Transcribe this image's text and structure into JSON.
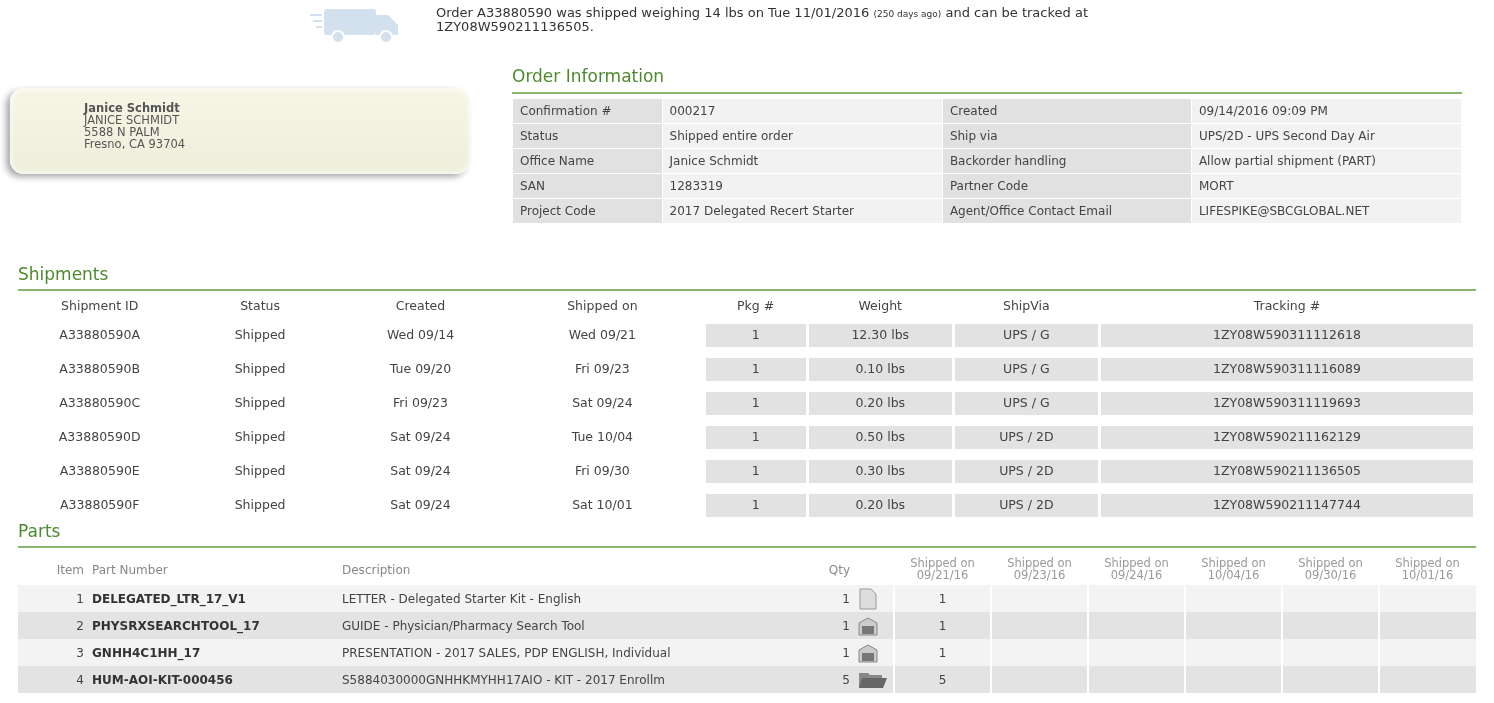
{
  "banner": {
    "text": "Order A33880590 was shipped weighing 14 lbs on Tue 11/01/2016",
    "age": "(250 days ago)",
    "text_after": "and can be tracked at",
    "tracking_link": "1ZY08W590211136505",
    "end": "."
  },
  "address": {
    "lines": [
      "Janice Schmidt",
      "JANICE SCHMIDT",
      "5588 N PALM",
      "Fresno, CA  93704"
    ]
  },
  "order_information": {
    "title": "Order Information",
    "rows": [
      {
        "label": "Confirmation #",
        "value": "000217",
        "label_2": "Created",
        "value_2": "09/14/2016 09:09 PM"
      },
      {
        "label": "Status",
        "value": "Shipped entire order",
        "label_2": "Ship via",
        "value_2": "UPS/2D - UPS Second Day Air"
      },
      {
        "label": "Office Name",
        "value": "Janice Schmidt",
        "label_2": "Backorder handling",
        "value_2": "Allow partial shipment (PART)"
      },
      {
        "label": "SAN",
        "value": "1283319",
        "label_2": "Partner Code",
        "value_2": "MORT"
      },
      {
        "label": "Project Code",
        "value": "2017 Delegated Recert Starter",
        "label_2": "Agent/Office Contact Email",
        "value_2": "LIFESPIKE@SBCGLOBAL.NET"
      }
    ]
  },
  "shipments": {
    "title": "Shipments",
    "columns": [
      "Shipment ID",
      "Status",
      "Created",
      "Shipped on",
      "Pkg #",
      "Weight",
      "ShipVia",
      "Tracking #"
    ],
    "rows": [
      [
        "A33880590A",
        "Shipped",
        "Wed 09/14",
        "Wed 09/21",
        "1",
        "12.30 lbs",
        "UPS / G",
        "1ZY08W590311112618"
      ],
      [
        "A33880590B",
        "Shipped",
        "Tue 09/20",
        "Fri 09/23",
        "1",
        "0.10 lbs",
        "UPS / G",
        "1ZY08W590311116089"
      ],
      [
        "A33880590C",
        "Shipped",
        "Fri 09/23",
        "Sat 09/24",
        "1",
        "0.20 lbs",
        "UPS / G",
        "1ZY08W590311119693"
      ],
      [
        "A33880590D",
        "Shipped",
        "Sat 09/24",
        "Tue 10/04",
        "1",
        "0.50 lbs",
        "UPS / 2D",
        "1ZY08W590211162129"
      ],
      [
        "A33880590E",
        "Shipped",
        "Sat 09/24",
        "Fri 09/30",
        "1",
        "0.30 lbs",
        "UPS / 2D",
        "1ZY08W590211136505"
      ],
      [
        "A33880590F",
        "Shipped",
        "Sat 09/24",
        "Sat 10/01",
        "1",
        "0.20 lbs",
        "UPS / 2D",
        "1ZY08W590211147744"
      ]
    ]
  },
  "parts": {
    "title": "Parts",
    "columns": [
      "Item",
      "Part Number",
      "Description",
      "Qty"
    ],
    "shipped_columns": [
      [
        "Shipped on",
        "09/21/16"
      ],
      [
        "Shipped on",
        "09/23/16"
      ],
      [
        "Shipped on",
        "09/24/16"
      ],
      [
        "Shipped on",
        "10/04/16"
      ],
      [
        "Shipped on",
        "09/30/16"
      ],
      [
        "Shipped on",
        "10/01/16"
      ]
    ],
    "rows": [
      {
        "item": "1",
        "part_number": "DELEGATED_LTR_17_V1",
        "description": "LETTER - Delegated Starter Kit - English",
        "qty": "1",
        "kind": "document",
        "shipped_qty": "1"
      },
      {
        "item": "2",
        "part_number": "PHYSRXSEARCHTOOL_17",
        "description": "GUIDE - Physician/Pharmacy Search Tool",
        "qty": "1",
        "kind": "warehouse",
        "shipped_qty": "1"
      },
      {
        "item": "3",
        "part_number": "GNHH4C1HH_17",
        "description": "PRESENTATION - 2017 SALES, PDP ENGLISH, Individual",
        "qty": "1",
        "kind": "warehouse",
        "shipped_qty": "1"
      },
      {
        "item": "4",
        "part_number": "HUM-AOI-KIT-000456",
        "description": "S5884030000GNHHKMYHH17AIO - KIT - 2017 Enrollm",
        "qty": "5",
        "kind": "folder",
        "shipped_qty": "5"
      }
    ]
  }
}
